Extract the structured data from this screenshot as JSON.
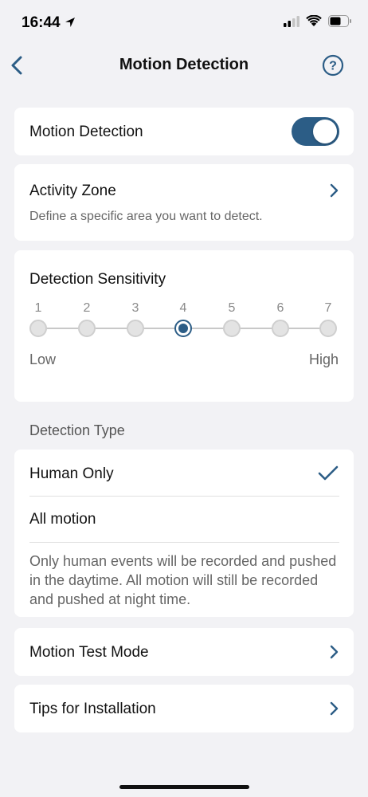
{
  "status_bar": {
    "time": "16:44"
  },
  "nav": {
    "title": "Motion Detection"
  },
  "motion_detection": {
    "label": "Motion Detection",
    "enabled": true
  },
  "activity_zone": {
    "label": "Activity Zone",
    "description": "Define a specific area you want to detect."
  },
  "sensitivity": {
    "label": "Detection Sensitivity",
    "steps": [
      "1",
      "2",
      "3",
      "4",
      "5",
      "6",
      "7"
    ],
    "selected": 4,
    "low_label": "Low",
    "high_label": "High"
  },
  "detection_type": {
    "header": "Detection Type",
    "options": [
      "Human Only",
      "All motion"
    ],
    "selected": "Human Only",
    "note": "Only human events will be recorded and pushed in the daytime. All motion will still be recorded and pushed at night time."
  },
  "motion_test_mode": {
    "label": "Motion Test Mode"
  },
  "tips": {
    "label": "Tips for Installation"
  },
  "colors": {
    "accent": "#2c5d86",
    "background": "#f2f2f5"
  }
}
